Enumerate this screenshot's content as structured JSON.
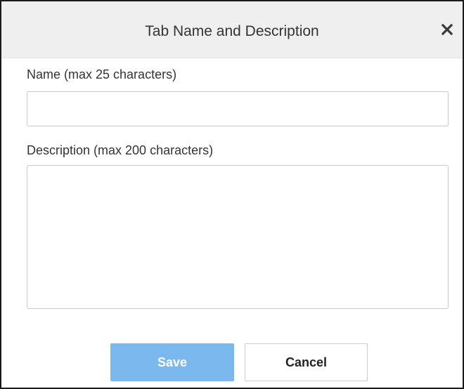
{
  "dialog": {
    "title": "Tab Name and Description",
    "close_icon": "close-icon"
  },
  "form": {
    "name_label": "Name (max 25 characters)",
    "name_value": "",
    "description_label": "Description (max 200 characters)",
    "description_value": ""
  },
  "buttons": {
    "save_label": "Save",
    "cancel_label": "Cancel"
  },
  "colors": {
    "save_bg": "#7bb8ee",
    "titlebar_bg": "#efefef"
  }
}
